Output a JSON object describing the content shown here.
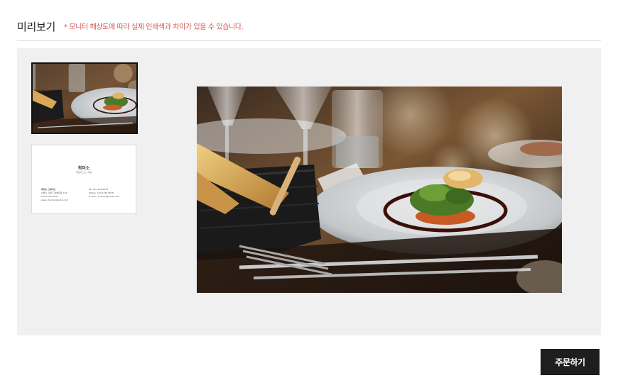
{
  "header": {
    "title": "미리보기",
    "notice": "* 모니터 해상도에 따라 실제 인쇄색과 차이가 있을 수 있습니다."
  },
  "thumbnails": [
    {
      "type": "photo",
      "selected": true
    },
    {
      "type": "business-card",
      "selected": false
    }
  ],
  "business_card": {
    "name": "최미소",
    "title": "플로리스트 / 대표",
    "company": "최미소 스튜디오",
    "address": "서울시 강남구 테헤란로 123",
    "phone": "010-1234-5678",
    "website": "www.choimisostudio.com",
    "tel": "Tel. 02-1234-5678",
    "mobile": "Mobile. 010-1234-5678",
    "email": "E-mail. choimiso@email.com"
  },
  "actions": {
    "order_label": "주문하기"
  },
  "colors": {
    "notice": "#d9534f",
    "preview_bg": "#f0f0f0",
    "button_bg": "#1e1e1e"
  }
}
